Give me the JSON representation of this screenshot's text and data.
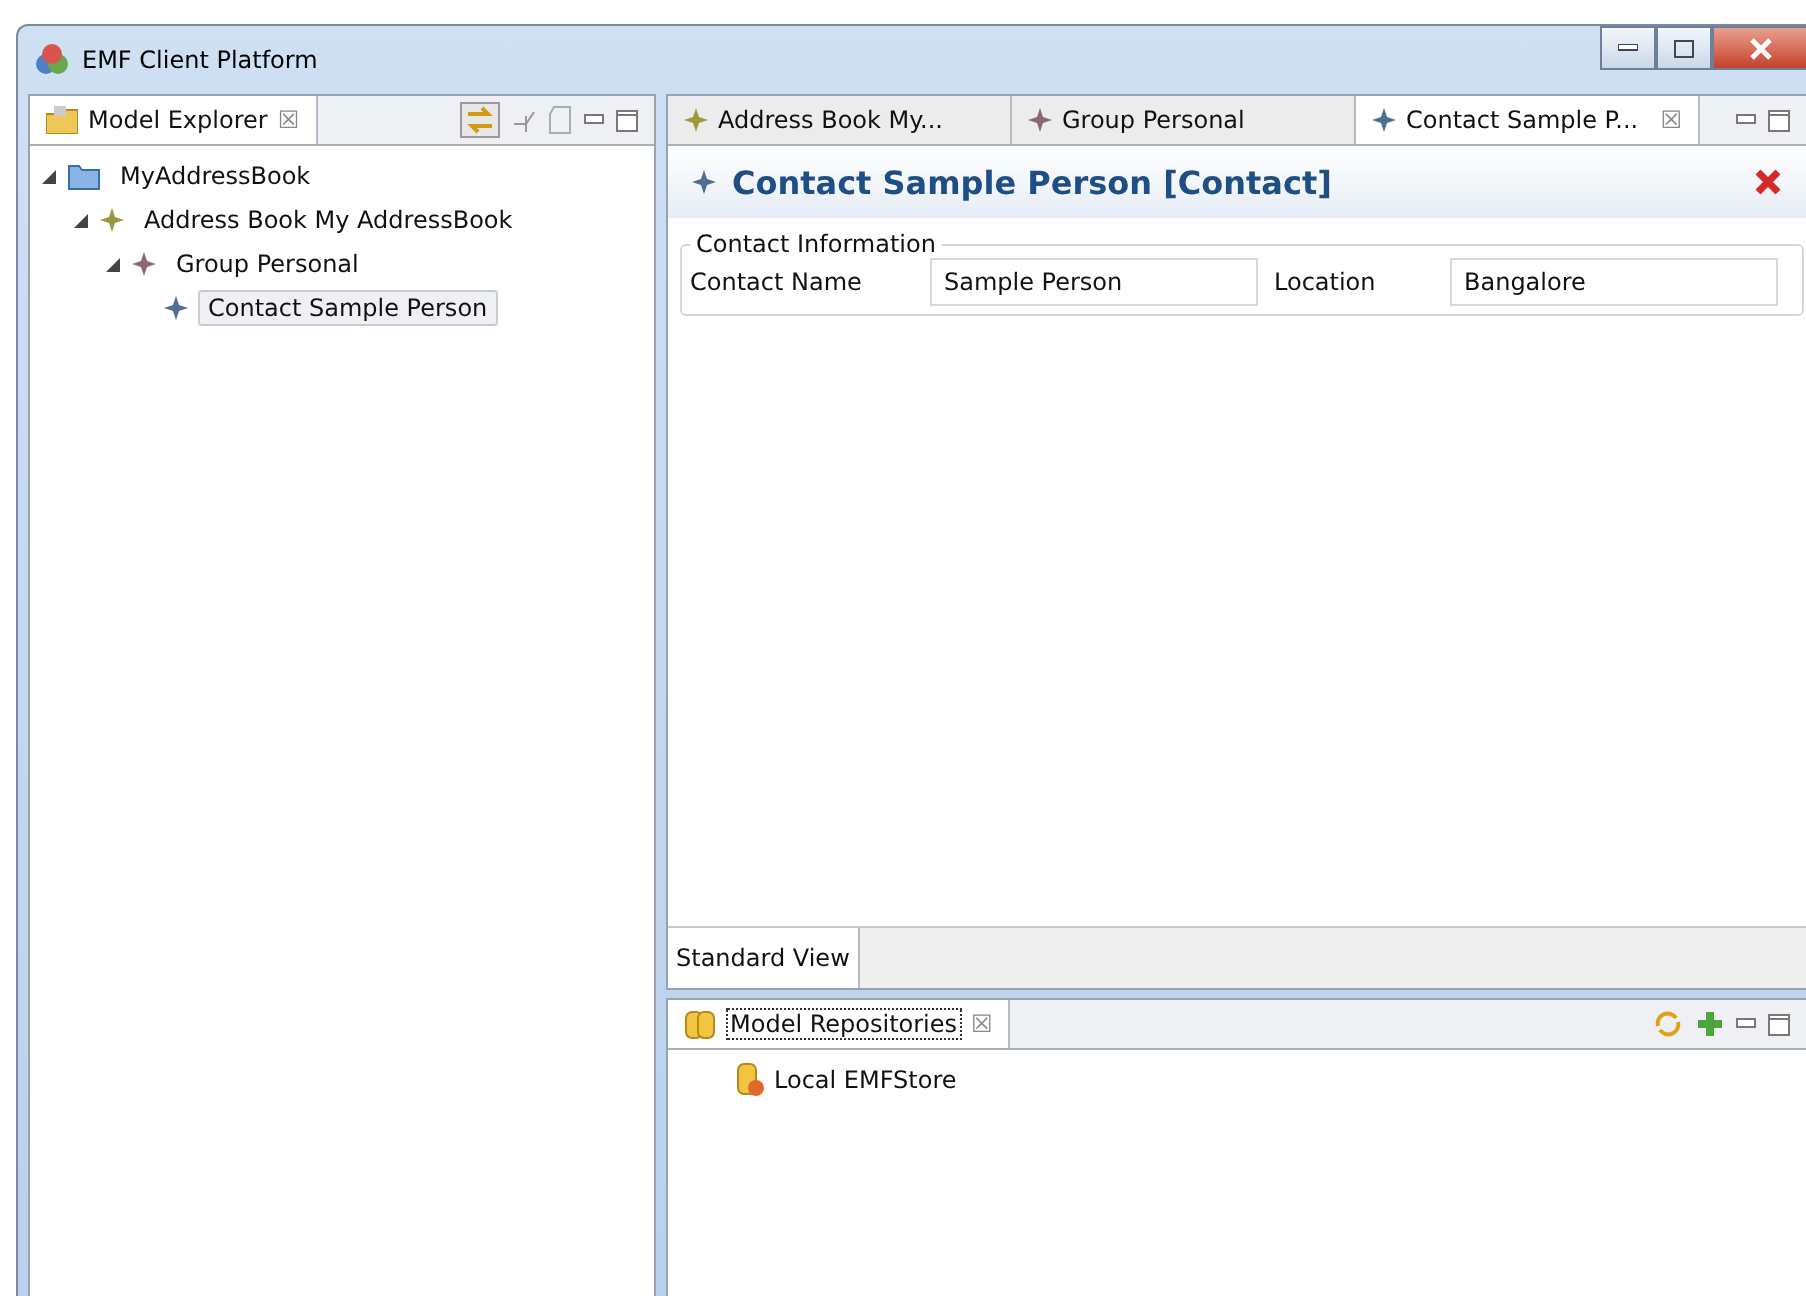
{
  "window": {
    "title": "EMF Client Platform"
  },
  "explorer": {
    "tab": "Model Explorer",
    "close": "☒",
    "tree": [
      {
        "label": "MyAddressBook",
        "kind": "folder",
        "expanded": true,
        "selected": false,
        "children": [
          {
            "label": "Address Book My AddressBook",
            "kind": "book",
            "expanded": true,
            "selected": false,
            "children": [
              {
                "label": "Group Personal",
                "kind": "group",
                "expanded": true,
                "selected": false,
                "children": [
                  {
                    "label": "Contact Sample Person",
                    "kind": "contact",
                    "selected": true
                  }
                ]
              }
            ]
          }
        ]
      }
    ]
  },
  "editor": {
    "tabs": [
      {
        "label": "Address Book My...",
        "kind": "book",
        "selected": false
      },
      {
        "label": "Group Personal",
        "kind": "group",
        "selected": false
      },
      {
        "label": "Contact Sample P...",
        "kind": "contact",
        "selected": true
      }
    ],
    "tab_close": "☒",
    "heading": "Contact Sample Person [Contact]",
    "section": "Contact Information",
    "fields": [
      {
        "label": "Contact Name",
        "value": "Sample Person"
      },
      {
        "label": "Location",
        "value": "Bangalore"
      }
    ],
    "bottom_tab": "Standard View"
  },
  "repositories": {
    "tab": "Model Repositories",
    "close": "☒",
    "items": [
      {
        "label": "Local EMFStore"
      }
    ]
  }
}
